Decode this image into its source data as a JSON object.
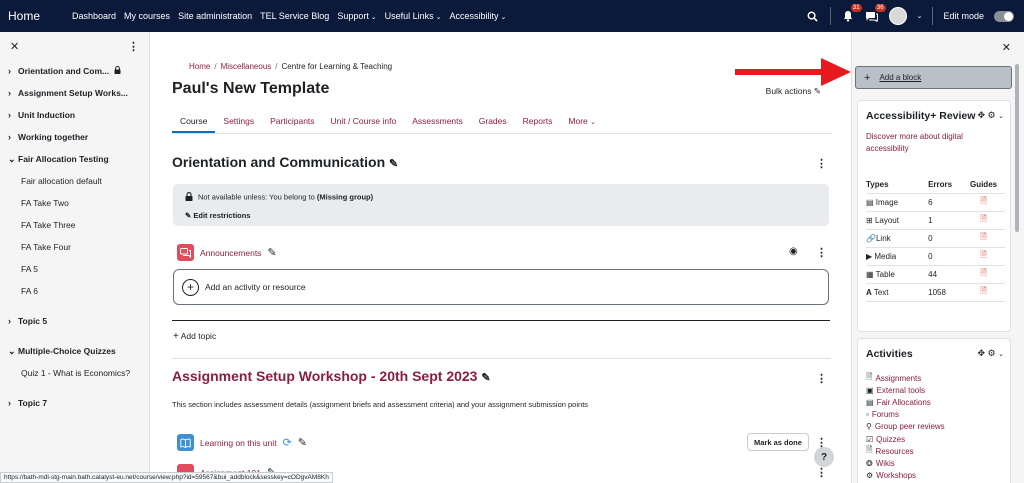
{
  "navbar": {
    "brand": "Home",
    "links": [
      {
        "label": "Dashboard",
        "dropdown": false
      },
      {
        "label": "My courses",
        "dropdown": false
      },
      {
        "label": "Site administration",
        "dropdown": false
      },
      {
        "label": "TEL Service Blog",
        "dropdown": false
      },
      {
        "label": "Support",
        "dropdown": true
      },
      {
        "label": "Useful Links",
        "dropdown": true
      },
      {
        "label": "Accessibility",
        "dropdown": true
      }
    ],
    "notifications_count": "31",
    "messages_count": "36",
    "edit_mode_label": "Edit mode",
    "edit_mode_on": true
  },
  "left_drawer": {
    "items": [
      {
        "label": "Orientation and Com...",
        "type": "section",
        "expanded": false,
        "locked": true
      },
      {
        "label": "Assignment Setup Works...",
        "type": "section",
        "expanded": false,
        "locked": false
      },
      {
        "label": "Unit Induction",
        "type": "section",
        "expanded": false,
        "locked": false
      },
      {
        "label": "Working together",
        "type": "section",
        "expanded": false,
        "locked": false
      },
      {
        "label": "Fair Allocation Testing",
        "type": "section",
        "expanded": true,
        "locked": false
      },
      {
        "label": "Fair allocation default",
        "type": "sub"
      },
      {
        "label": "FA Take Two",
        "type": "sub"
      },
      {
        "label": "FA Take Three",
        "type": "sub"
      },
      {
        "label": "FA Take Four",
        "type": "sub"
      },
      {
        "label": "FA 5",
        "type": "sub"
      },
      {
        "label": "FA 6",
        "type": "sub"
      },
      {
        "label": "Topic 5",
        "type": "section",
        "expanded": false,
        "locked": false
      },
      {
        "label": "Multiple-Choice Quizzes",
        "type": "section",
        "expanded": true,
        "locked": false
      },
      {
        "label": "Quiz 1 - What is Economics?",
        "type": "sub"
      },
      {
        "label": "Topic 7",
        "type": "section",
        "expanded": false,
        "locked": false
      }
    ]
  },
  "main": {
    "breadcrumb": [
      "Home",
      "Miscellaneous",
      "Centre for Learning & Teaching"
    ],
    "page_title": "Paul's New Template",
    "bulk_actions": "Bulk actions",
    "tabs": [
      "Course",
      "Settings",
      "Participants",
      "Unit / Course info",
      "Assessments",
      "Grades",
      "Reports",
      "More"
    ],
    "section1": {
      "title": "Orientation and Communication",
      "restriction_prefix": "Not available unless: You belong to",
      "restriction_group": "(Missing group)",
      "edit_restrictions": "Edit restrictions",
      "activity": "Announcements",
      "add_activity": "Add an activity or resource"
    },
    "add_topic": "Add topic",
    "section2": {
      "title": "Assignment Setup Workshop - 20th Sept 2023",
      "description": "This section includes assessment details (assignment briefs and assessment criteria) and your assignment submission points",
      "activity1": "Learning on this unit",
      "mark_as_done": "Mark as done",
      "activity2": "Assignment 101"
    },
    "help": "?"
  },
  "right_drawer": {
    "add_block": "Add a block",
    "accessibility_block": {
      "title": "Accessibility+ Review",
      "link": "Discover more about digital accessibility",
      "headers": [
        "Types",
        "Errors",
        "Guides"
      ],
      "rows": [
        {
          "type": "Image",
          "errors": "6"
        },
        {
          "type": "Layout",
          "errors": "1"
        },
        {
          "type": "Link",
          "errors": "0"
        },
        {
          "type": "Media",
          "errors": "0"
        },
        {
          "type": "Table",
          "errors": "44"
        },
        {
          "type": "Text",
          "errors": "1058"
        }
      ]
    },
    "activities_block": {
      "title": "Activities",
      "items": [
        "Assignments",
        "External tools",
        "Fair Allocations",
        "Forums",
        "Group peer reviews",
        "Quizzes",
        "Resources",
        "Wikis",
        "Workshops"
      ]
    }
  },
  "status_url": "https://bath-mdl-stg-main.bath.catalyst-eu.net/course/view.php?id=59567&bui_addblock&sesskey=cODgvAM8Kh",
  "colors": {
    "navbar": "#0b1a3a",
    "link": "#8b1e3f",
    "arrow": "#e8191f",
    "active_tab": "#0f6cbf"
  }
}
